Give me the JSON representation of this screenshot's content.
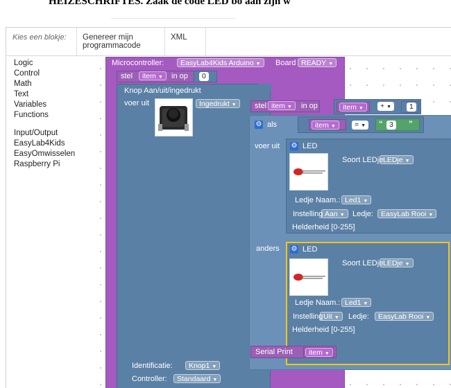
{
  "document": {
    "heading": "HEIZESCHRIFTES. Zaak de code LED bo aan zijn w"
  },
  "tabs": {
    "category_hint": "Kies een blokje:",
    "generate": "Genereer mijn programmacode",
    "xml": "XML"
  },
  "toolbox": {
    "groups": [
      [
        "Logic",
        "Control",
        "Math",
        "Text",
        "Variables",
        "Functions"
      ],
      [
        "Input/Output",
        "EasyLab4Kids",
        "EasyOmwisselen",
        "Raspberry Pi"
      ]
    ]
  },
  "blocks": {
    "micro": {
      "label": "Microcontroller:",
      "board_value": "EasyLab4Kids Arduino",
      "board_label": "Board",
      "status": "READY"
    },
    "set_top": {
      "stel": "stel",
      "var": "item",
      "in_op": "in op",
      "value": "0"
    },
    "knop": {
      "title": "Knop Aan/uit/ingedrukt",
      "voer_uit": "voer uit",
      "state": "Ingedrukt",
      "ident_label": "Identificatie:",
      "ident_value": "Knop1",
      "controller_label": "Controller:",
      "controller_value": "Standaard"
    },
    "set_inc": {
      "stel": "stel",
      "var": "item",
      "in_op": "in op",
      "var2": "item",
      "op": "+",
      "num": "1"
    },
    "if_block": {
      "als": "als",
      "var": "item",
      "op": "=",
      "str": "3",
      "voer_uit": "voer uit",
      "anders": "anders"
    },
    "led1": {
      "title": "LED",
      "soort_label": "Soort LEDje",
      "soort_value": "LEDje",
      "naam_label": "Ledje Naam.:",
      "naam_value": "Led1",
      "instelling_label": "Instelling",
      "instelling_value": "Aan",
      "ledje_label": "Ledje:",
      "ledje_value": "EasyLab Rooi",
      "helderheid": "Helderheid [0-255]"
    },
    "led2": {
      "title": "LED",
      "soort_label": "Soort LEDje",
      "soort_value": "LEDje",
      "naam_label": "Ledje Naam.:",
      "naam_value": "Led1",
      "instelling_label": "Instelling",
      "instelling_value": "Uit",
      "ledje_label": "Ledje:",
      "ledje_value": "EasyLab Rooi",
      "helderheid": "Helderheid [0-255]"
    },
    "serial": {
      "label": "Serial Print",
      "var": "item"
    }
  },
  "colors": {
    "control_purple": "#a45ac0",
    "io_blue": "#5b80a5",
    "selection_yellow": "#f3c614",
    "gear_blue": "#2d6dd2"
  }
}
